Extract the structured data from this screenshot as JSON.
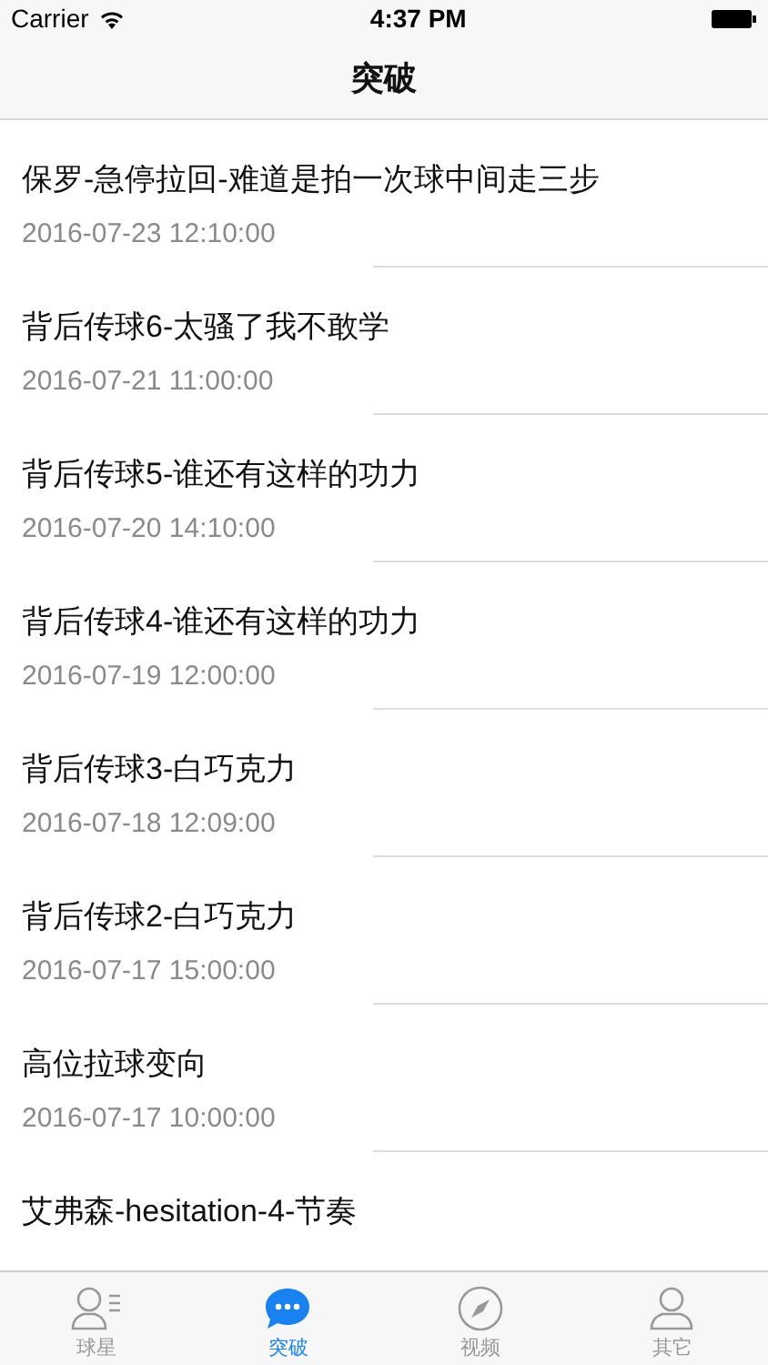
{
  "status_bar": {
    "carrier": "Carrier",
    "time": "4:37 PM"
  },
  "nav": {
    "title": "突破"
  },
  "items": [
    {
      "title": "保罗-急停拉回-难道是拍一次球中间走三步",
      "date": "2016-07-23 12:10:00"
    },
    {
      "title": "背后传球6-太骚了我不敢学",
      "date": "2016-07-21 11:00:00"
    },
    {
      "title": "背后传球5-谁还有这样的功力",
      "date": "2016-07-20 14:10:00"
    },
    {
      "title": "背后传球4-谁还有这样的功力",
      "date": "2016-07-19 12:00:00"
    },
    {
      "title": "背后传球3-白巧克力",
      "date": "2016-07-18 12:09:00"
    },
    {
      "title": "背后传球2-白巧克力",
      "date": "2016-07-17 15:00:00"
    },
    {
      "title": "高位拉球变向",
      "date": "2016-07-17 10:00:00"
    },
    {
      "title": "艾弗森-hesitation-4-节奏"
    }
  ],
  "tabs": [
    {
      "label": "球星",
      "kind": "players",
      "selected": false
    },
    {
      "label": "突破",
      "kind": "chat",
      "selected": true
    },
    {
      "label": "视频",
      "kind": "compass",
      "selected": false
    },
    {
      "label": "其它",
      "kind": "person",
      "selected": false
    }
  ]
}
